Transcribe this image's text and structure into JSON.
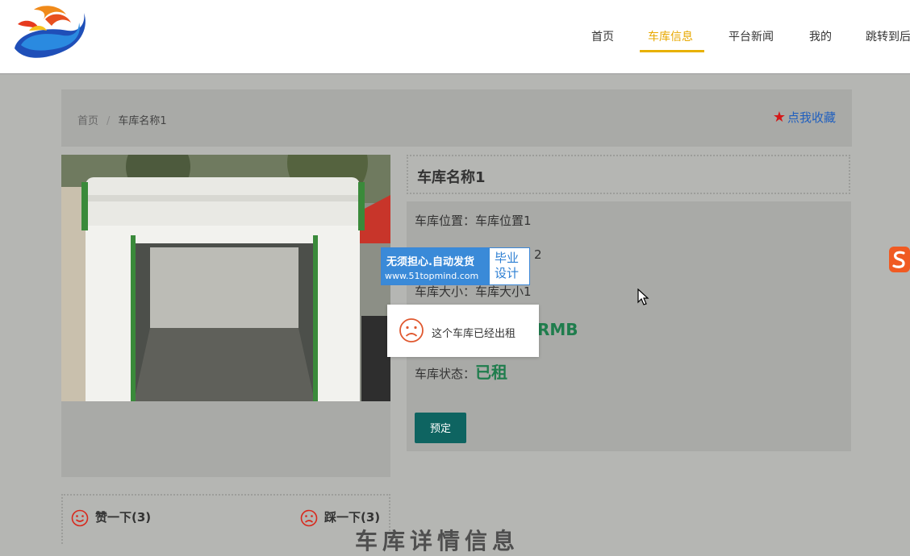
{
  "header": {
    "logo_icon": "flame-logo-icon",
    "nav": [
      {
        "label": "首页",
        "active": false
      },
      {
        "label": "车库信息",
        "active": true
      },
      {
        "label": "平台新闻",
        "active": false
      },
      {
        "label": "我的",
        "active": false
      },
      {
        "label": "跳转到后",
        "active": false
      }
    ],
    "active_color": "#e8a800"
  },
  "breadcrumb": {
    "home": "首页",
    "separator": "/",
    "current": "车库名称1"
  },
  "favorite": {
    "label": "点我收藏",
    "icon": "star-icon"
  },
  "detail": {
    "title": "车库名称1",
    "location_label": "车库位置：",
    "location_value": "车库位置1",
    "row2_value": "2",
    "size_label": "车库大小：",
    "size_value": "车库大小1",
    "price_value": "RMB",
    "status_label": "车库状态：",
    "status_value": "已租",
    "book_button": "预定"
  },
  "votes": {
    "like": "赞一下(3)",
    "dislike": "踩一下(3)"
  },
  "toast": {
    "message": "这个车库已经出租",
    "icon": "sad-face-icon"
  },
  "watermark": {
    "line1": "无须担心.自动发货",
    "line2": "www.51topmind.com",
    "badge_line1": "毕业",
    "badge_line2": "设计"
  },
  "bottom_overlay_text": "车库详情信息",
  "colors": {
    "accent_green": "#1f7d4d",
    "button_bg": "#0e6461",
    "fav_link": "#1f5fbf"
  }
}
